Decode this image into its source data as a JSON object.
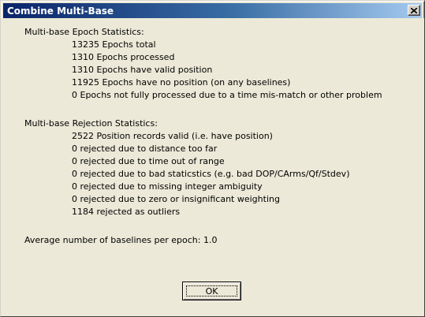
{
  "window": {
    "title": "Combine Multi-Base",
    "close_icon": "close-icon"
  },
  "epoch": {
    "heading": "Multi-base Epoch Statistics:",
    "lines": [
      "13235 Epochs total",
      "1310 Epochs processed",
      "1310 Epochs have valid position",
      "11925 Epochs have no position (on any baselines)",
      "0 Epochs not fully processed due to a time mis-match or other problem"
    ]
  },
  "rejection": {
    "heading": "Multi-base Rejection Statistics:",
    "lines": [
      "2522 Position records valid (i.e. have position)",
      "0 rejected due to distance too far",
      "0 rejected due to time out of range",
      "0 rejected due to bad staticstics (e.g. bad DOP/CArms/Qf/Stdev)",
      "0 rejected due to missing integer ambiguity",
      "0 rejected due to zero or insignificant weighting",
      "1184 rejected as outliers"
    ]
  },
  "average": {
    "text": "Average number of baselines per epoch: 1.0"
  },
  "buttons": {
    "ok_label": "OK"
  }
}
